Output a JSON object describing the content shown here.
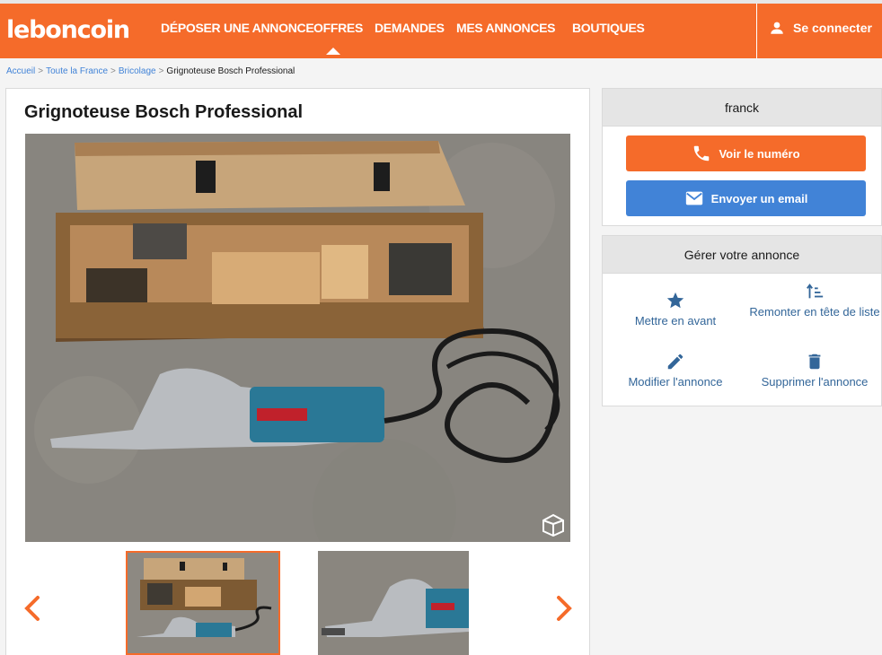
{
  "header": {
    "logo": "leboncoin",
    "nav": [
      {
        "label": "DÉPOSER UNE ANNONCE"
      },
      {
        "label": "OFFRES"
      },
      {
        "label": "DEMANDES"
      },
      {
        "label": "MES ANNONCES"
      },
      {
        "label": "BOUTIQUES"
      }
    ],
    "active_nav": "OFFRES",
    "login_label": "Se connecter",
    "login_icon": "user-icon"
  },
  "breadcrumb": {
    "items": [
      "Accueil",
      "Toute la France",
      "Bricolage"
    ],
    "separator": ">",
    "current": "Grignoteuse Bosch Professional"
  },
  "ad": {
    "title": "Grignoteuse Bosch Professional",
    "photo_count_visible": 2,
    "active_thumbnail": 1
  },
  "seller": {
    "name": "franck",
    "phone_button": "Voir le numéro",
    "email_button": "Envoyer un email"
  },
  "manage": {
    "title": "Gérer votre annonce",
    "actions": [
      {
        "label": "Mettre en avant",
        "icon": "star-icon"
      },
      {
        "label": "Remonter en tête de liste",
        "icon": "sort-up-icon"
      },
      {
        "label": "Modifier l'annonce",
        "icon": "pencil-icon"
      },
      {
        "label": "Supprimer l'annonce",
        "icon": "trash-icon"
      }
    ]
  },
  "colors": {
    "brand": "#f56b2a",
    "email": "#4183d7",
    "link": "#336699"
  }
}
